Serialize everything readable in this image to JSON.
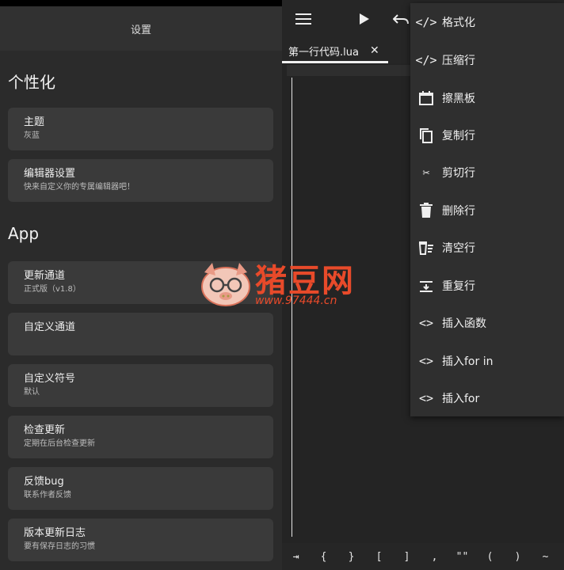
{
  "settings": {
    "header_title": "设置",
    "section_personal": "个性化",
    "section_app": "App",
    "items": [
      {
        "title": "主题",
        "sub": "灰蓝"
      },
      {
        "title": "编辑器设置",
        "sub": "快来自定义你的专属编辑器吧！"
      },
      {
        "title": "更新通道",
        "sub": "正式版（v1.8）"
      },
      {
        "title": "自定义通道",
        "sub": ""
      },
      {
        "title": "自定义符号",
        "sub": "默认"
      },
      {
        "title": "检查更新",
        "sub": "定期在后台检查更新"
      },
      {
        "title": "反馈bug",
        "sub": "联系作者反馈"
      },
      {
        "title": "版本更新日志",
        "sub": "要有保存日志的习惯"
      }
    ]
  },
  "editor": {
    "tab_label": "第一行代码.lua",
    "tab_close": "✕",
    "symbols": [
      "⇥",
      "{",
      "}",
      "[",
      "]",
      ",",
      "\"\"",
      "(",
      ")",
      "~"
    ]
  },
  "menu": {
    "items": [
      {
        "icon": "code-icon",
        "label": "格式化"
      },
      {
        "icon": "code-icon",
        "label": "压缩行"
      },
      {
        "icon": "calendar-icon",
        "label": "擦黑板"
      },
      {
        "icon": "copy-icon",
        "label": "复制行"
      },
      {
        "icon": "scissors-icon",
        "label": "剪切行"
      },
      {
        "icon": "trash-icon",
        "label": "删除行"
      },
      {
        "icon": "clear-line-icon",
        "label": "清空行"
      },
      {
        "icon": "duplicate-line-icon",
        "label": "重复行"
      },
      {
        "icon": "brackets-icon",
        "label": "插入函数"
      },
      {
        "icon": "brackets-icon",
        "label": "插入for in"
      },
      {
        "icon": "brackets-icon",
        "label": "插入for"
      }
    ]
  },
  "watermark": {
    "brand": "猪豆网",
    "url": "www.97444.cn"
  },
  "colors": {
    "watermark": "#e84a2a",
    "background": "#242424",
    "card": "#3a3a3a"
  }
}
